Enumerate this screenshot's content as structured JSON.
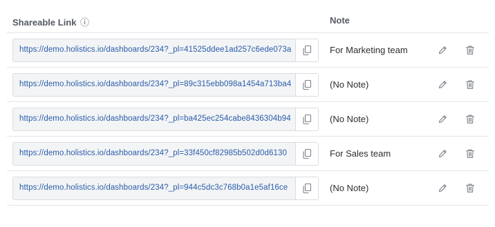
{
  "header": {
    "link_label": "Shareable Link",
    "info_glyph": "ⓘ",
    "note_label": "Note"
  },
  "rows": [
    {
      "url": "https://demo.holistics.io/dashboards/234?_pl=41525ddee1ad257c6ede073a",
      "note": "For Marketing team"
    },
    {
      "url": "https://demo.holistics.io/dashboards/234?_pl=89c315ebb098a1454a713ba4",
      "note": "(No Note)"
    },
    {
      "url": "https://demo.holistics.io/dashboards/234?_pl=ba425ec254cabe8436304b94",
      "note": "(No Note)"
    },
    {
      "url": "https://demo.holistics.io/dashboards/234?_pl=33f450cf82985b502d0d6130",
      "note": "For Sales team"
    },
    {
      "url": "https://demo.holistics.io/dashboards/234?_pl=944c5dc3c768b0a1e5af16ce",
      "note": "(No Note)"
    }
  ],
  "icons": {
    "copy": "copy-icon",
    "edit": "pencil-icon",
    "delete": "trash-icon"
  },
  "colors": {
    "link": "#2a5da8",
    "border": "#e3e5ea",
    "icon": "#7a7f88"
  }
}
